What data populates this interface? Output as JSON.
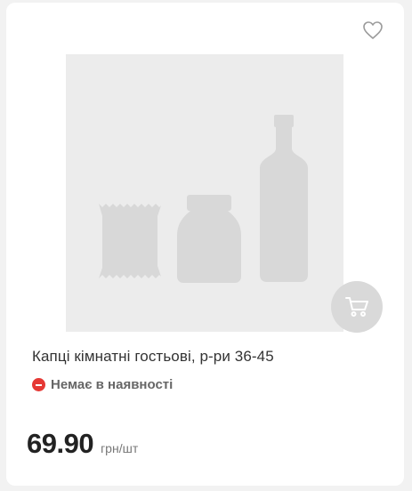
{
  "product": {
    "title": "Капці кімнатні гостьові, р-ри 36-45",
    "availability": "Немає в наявності",
    "price": "69.90",
    "unit": "грн/шт"
  },
  "icons": {
    "favorite": "heart-icon",
    "cart": "cart-icon",
    "status": "minus-circle-icon"
  },
  "colors": {
    "status_red": "#e53935",
    "placeholder_bg": "#ececec",
    "placeholder_shapes": "#d8d8d8",
    "cart_button_bg": "#d9d9d9"
  }
}
